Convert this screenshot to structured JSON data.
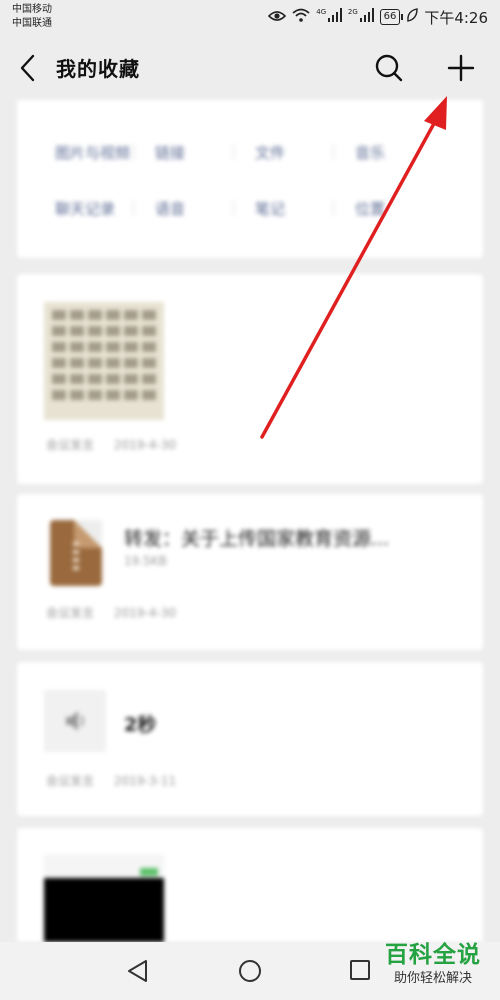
{
  "status_bar": {
    "carrier_1": "中国移动",
    "carrier_2": "中国联通",
    "net_1": "4G",
    "net_2": "2G",
    "battery": "66",
    "time": "下午4:26"
  },
  "header": {
    "title": "我的收藏"
  },
  "categories": [
    [
      "图片与视频",
      "链接",
      "文件",
      "音乐"
    ],
    [
      "聊天记录",
      "语音",
      "笔记",
      "位置"
    ]
  ],
  "items": [
    {
      "kind": "image",
      "source": "会议发言",
      "date": "2019-4-30"
    },
    {
      "kind": "file",
      "title": "转发：关于上传国家教育资源...",
      "size": "19.5KB",
      "source": "会议发言",
      "date": "2019-4-30"
    },
    {
      "kind": "voice",
      "duration": "2秒",
      "source": "会议发言",
      "date": "2019-3-11"
    },
    {
      "kind": "video"
    }
  ],
  "watermark": {
    "title": "百科全说",
    "subtitle": "助你轻松解决"
  },
  "colors": {
    "arrow": "#e02020",
    "category_text": "#5d6c94",
    "watermark_green": "#25a241"
  },
  "icons": [
    "back-arrow-icon",
    "search-icon",
    "plus-icon",
    "eye-icon",
    "wifi-icon",
    "leaf-icon",
    "file-zip-icon",
    "speaker-icon",
    "nav-back-icon",
    "nav-home-icon",
    "nav-recent-icon"
  ]
}
